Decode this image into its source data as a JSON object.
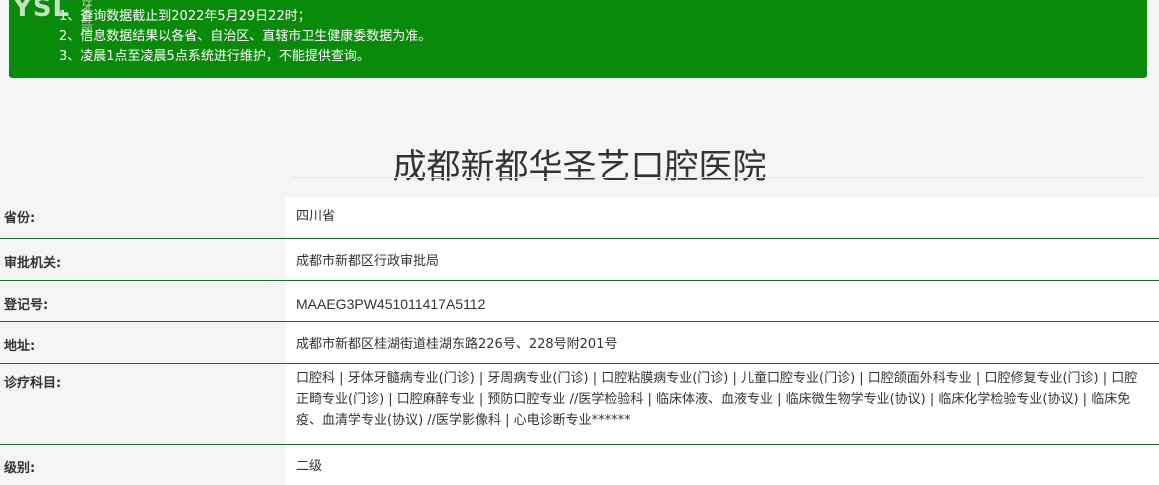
{
  "notice": {
    "logo_text": "YSL",
    "logo_sub": "牙舒丽",
    "lines": [
      "1、查询数据截止到2022年5月29日22时；",
      "2、信息数据结果以各省、自治区、直辖市卫生健康委数据为准。",
      "3、凌晨1点至凌晨5点系统进行维护，不能提供查询。"
    ],
    "bg_color": "#0a8a0a"
  },
  "title": "成都新都华圣艺口腔医院",
  "rows": [
    {
      "label": "省份:",
      "value": "四川省"
    },
    {
      "label": "审批机关:",
      "value": "成都市新都区行政审批局"
    },
    {
      "label": "登记号:",
      "value": "MAAEG3PW451011417A5112"
    },
    {
      "label": "地址:",
      "value": "成都市新都区桂湖街道桂湖东路226号、228号附201号"
    },
    {
      "label": "诊疗科目:",
      "value": "口腔科 | 牙体牙髓病专业(门诊) | 牙周病专业(门诊) | 口腔粘膜病专业(门诊) | 儿童口腔专业(门诊) | 口腔颌面外科专业 | 口腔修复专业(门诊) | 口腔正畸专业(门诊) | 口腔麻醉专业 | 预防口腔专业 //医学检验科 | 临床体液、血液专业 | 临床微生物学专业(协议) | 临床化学检验专业(协议) | 临床免疫、血清学专业(协议) //医学影像科 | 心电诊断专业******"
    },
    {
      "label": "级别:",
      "value": "二级"
    }
  ],
  "colors": {
    "row_border": "#1e6b3a",
    "label_bg": "#f5f5f5",
    "value_bg": "#ffffff"
  }
}
